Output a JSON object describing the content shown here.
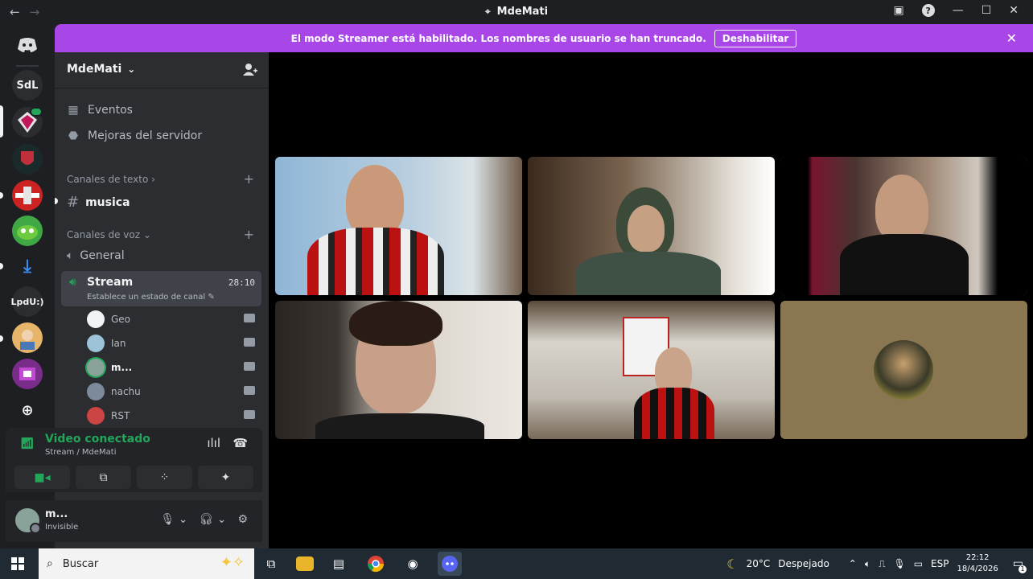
{
  "window": {
    "title": "MdeMati",
    "nav_back": "←",
    "nav_forward": "→",
    "controls": {
      "inbox": "▣",
      "help": "?",
      "minimize": "—",
      "maximize": "☐",
      "close": "✕"
    }
  },
  "banner": {
    "message": "El modo Streamer está habilitado. Los nombres de usuario se han truncado.",
    "button": "Deshabilitar",
    "close": "✕"
  },
  "rail": {
    "servers": [
      {
        "label": "SdL"
      },
      {
        "label": "LpdU:)"
      }
    ]
  },
  "sidebar": {
    "server_name": "MdeMati",
    "chevron": "⌄",
    "items": [
      {
        "label": "Eventos",
        "icon": "calendar-icon"
      },
      {
        "label": "Mejoras del servidor",
        "icon": "boost-icon"
      }
    ],
    "text_category": "Canales de texto",
    "text_channels": [
      {
        "name": "musica"
      }
    ],
    "voice_category": "Canales de voz",
    "voice_channels": [
      {
        "name": "General"
      },
      {
        "name": "Stream",
        "time": "28:10",
        "status": "Establece un estado de canal"
      }
    ],
    "voice_users": [
      {
        "name": "Geo",
        "color": "#f2f3f5"
      },
      {
        "name": "Ian",
        "color": "#9cc3d8"
      },
      {
        "name": "m...",
        "color": "#8aa39a"
      },
      {
        "name": "nachu",
        "color": "#7d8a9c"
      },
      {
        "name": "RST",
        "color": "#c44"
      }
    ]
  },
  "voice_panel": {
    "title": "Video conectado",
    "subtitle": "Stream / MdeMati"
  },
  "user_panel": {
    "name": "m...",
    "status": "Invisible"
  },
  "taskbar": {
    "search_placeholder": "Buscar",
    "weather_temp": "20°C",
    "weather_text": "Despejado",
    "language": "ESP",
    "time": "22:12",
    "date": "18/4/2026",
    "notification_count": "1"
  },
  "colors": {
    "accent_purple": "#a846e8",
    "voice_green": "#23a55a",
    "sidebar_bg": "#2b2d31",
    "rail_bg": "#1e1f22"
  }
}
